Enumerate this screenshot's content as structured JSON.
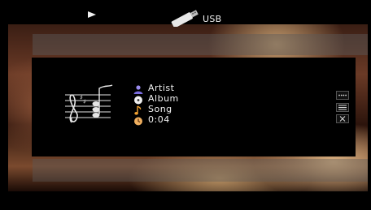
{
  "topbar": {
    "play_icon": "play-icon",
    "source_icon": "usb-stick-icon",
    "source_label": "USB"
  },
  "track": {
    "artist": "Artist",
    "album": "Album",
    "song": "Song",
    "elapsed": "0:04"
  },
  "icons": {
    "artist": "artist-icon",
    "album": "album-icon",
    "song": "note-icon",
    "time": "clock-icon",
    "art": "music-notation-icon"
  },
  "controls": [
    "more-options-icon",
    "list-icon",
    "close-icon"
  ]
}
